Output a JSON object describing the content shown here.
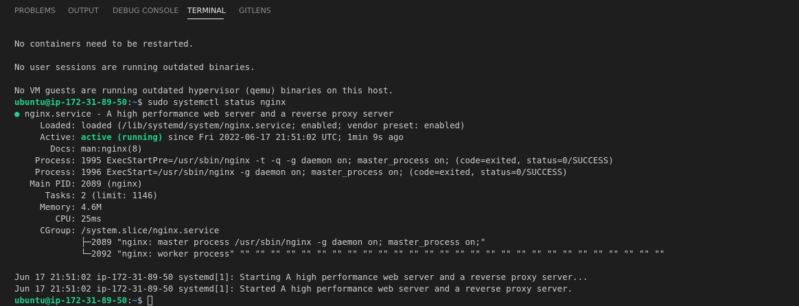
{
  "panel": {
    "tabs": [
      {
        "label": "PROBLEMS"
      },
      {
        "label": "OUTPUT"
      },
      {
        "label": "DEBUG CONSOLE"
      },
      {
        "label": "TERMINAL"
      },
      {
        "label": "GITLENS"
      }
    ]
  },
  "terminal": {
    "msg_containers": "No containers need to be restarted.",
    "msg_sessions": "No user sessions are running outdated binaries.",
    "msg_vm": "No VM guests are running outdated hypervisor (qemu) binaries on this host.",
    "prompt": {
      "user_host": "ubuntu@ip-172-31-89-50",
      "sep": ":",
      "path": "~",
      "symbol": "$ "
    },
    "command": "sudo systemctl status nginx",
    "service_bullet": "●",
    "service_line": " nginx.service - A high performance web server and a reverse proxy server",
    "loaded_line": "     Loaded: loaded (/lib/systemd/system/nginx.service; enabled; vendor preset: enabled)",
    "active_label": "     Active: ",
    "active_state": "active (running)",
    "active_rest": " since Fri 2022-06-17 21:51:02 UTC; 1min 9s ago",
    "docs_line": "       Docs: man:nginx(8)",
    "process1_line": "    Process: 1995 ExecStartPre=/usr/sbin/nginx -t -q -g daemon on; master_process on; (code=exited, status=0/SUCCESS)",
    "process2_line": "    Process: 1996 ExecStart=/usr/sbin/nginx -g daemon on; master_process on; (code=exited, status=0/SUCCESS)",
    "mainpid_line": "   Main PID: 2089 (nginx)",
    "tasks_line": "      Tasks: 2 (limit: 1146)",
    "memory_line": "     Memory: 4.6M",
    "cpu_line": "        CPU: 25ms",
    "cgroup_line": "     CGroup: /system.slice/nginx.service",
    "cgroup_child1": "             ├─2089 \"nginx: master process /usr/sbin/nginx -g daemon on; master_process on;\"",
    "cgroup_child2": "             └─2092 \"nginx: worker process\" \"\" \"\" \"\" \"\" \"\" \"\" \"\" \"\" \"\" \"\" \"\" \"\" \"\" \"\" \"\" \"\" \"\" \"\" \"\" \"\" \"\" \"\" \"\" \"\" \"\" \"\" \"\" \"\"",
    "log1": "Jun 17 21:51:02 ip-172-31-89-50 systemd[1]: Starting A high performance web server and a reverse proxy server...",
    "log2": "Jun 17 21:51:02 ip-172-31-89-50 systemd[1]: Started A high performance web server and a reverse proxy server."
  },
  "colors": {
    "background": "#1e1e1e",
    "text": "#cccccc",
    "prompt_user": "#23d18b",
    "prompt_path": "#3b8eea",
    "active": "#23d18b"
  }
}
